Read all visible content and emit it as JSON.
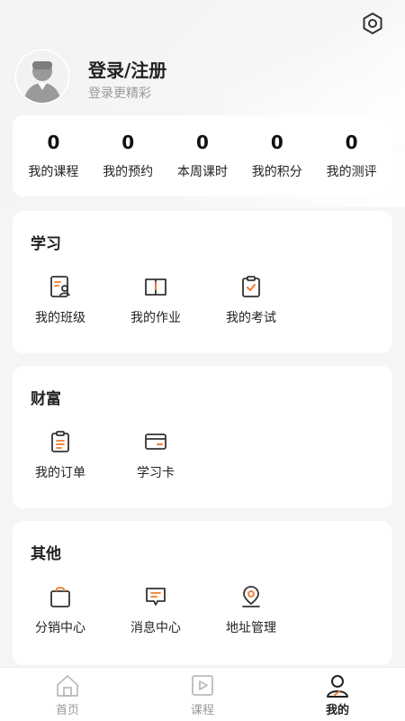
{
  "colors": {
    "accent": "#f07b2b",
    "text": "#222222",
    "muted": "#999999",
    "background": "#f5f5f5"
  },
  "header": {
    "settings_icon": "gear-icon",
    "login_title": "登录/注册",
    "login_subtitle": "登录更精彩"
  },
  "stats": [
    {
      "value": "0",
      "label": "我的课程"
    },
    {
      "value": "0",
      "label": "我的预约"
    },
    {
      "value": "0",
      "label": "本周课时"
    },
    {
      "value": "0",
      "label": "我的积分"
    },
    {
      "value": "0",
      "label": "我的测评"
    }
  ],
  "sections": {
    "study": {
      "title": "学习",
      "items": [
        {
          "label": "我的班级",
          "icon": "class-icon"
        },
        {
          "label": "我的作业",
          "icon": "homework-icon"
        },
        {
          "label": "我的考试",
          "icon": "exam-icon"
        }
      ]
    },
    "wealth": {
      "title": "财富",
      "items": [
        {
          "label": "我的订单",
          "icon": "order-icon"
        },
        {
          "label": "学习卡",
          "icon": "card-icon"
        }
      ]
    },
    "other": {
      "title": "其他",
      "items": [
        {
          "label": "分销中心",
          "icon": "bag-icon"
        },
        {
          "label": "消息中心",
          "icon": "message-icon"
        },
        {
          "label": "地址管理",
          "icon": "location-icon"
        }
      ]
    }
  },
  "bottom_nav": [
    {
      "label": "首页",
      "icon": "home-icon"
    },
    {
      "label": "课程",
      "icon": "course-icon"
    },
    {
      "label": "我的",
      "icon": "profile-icon",
      "active": true
    }
  ]
}
